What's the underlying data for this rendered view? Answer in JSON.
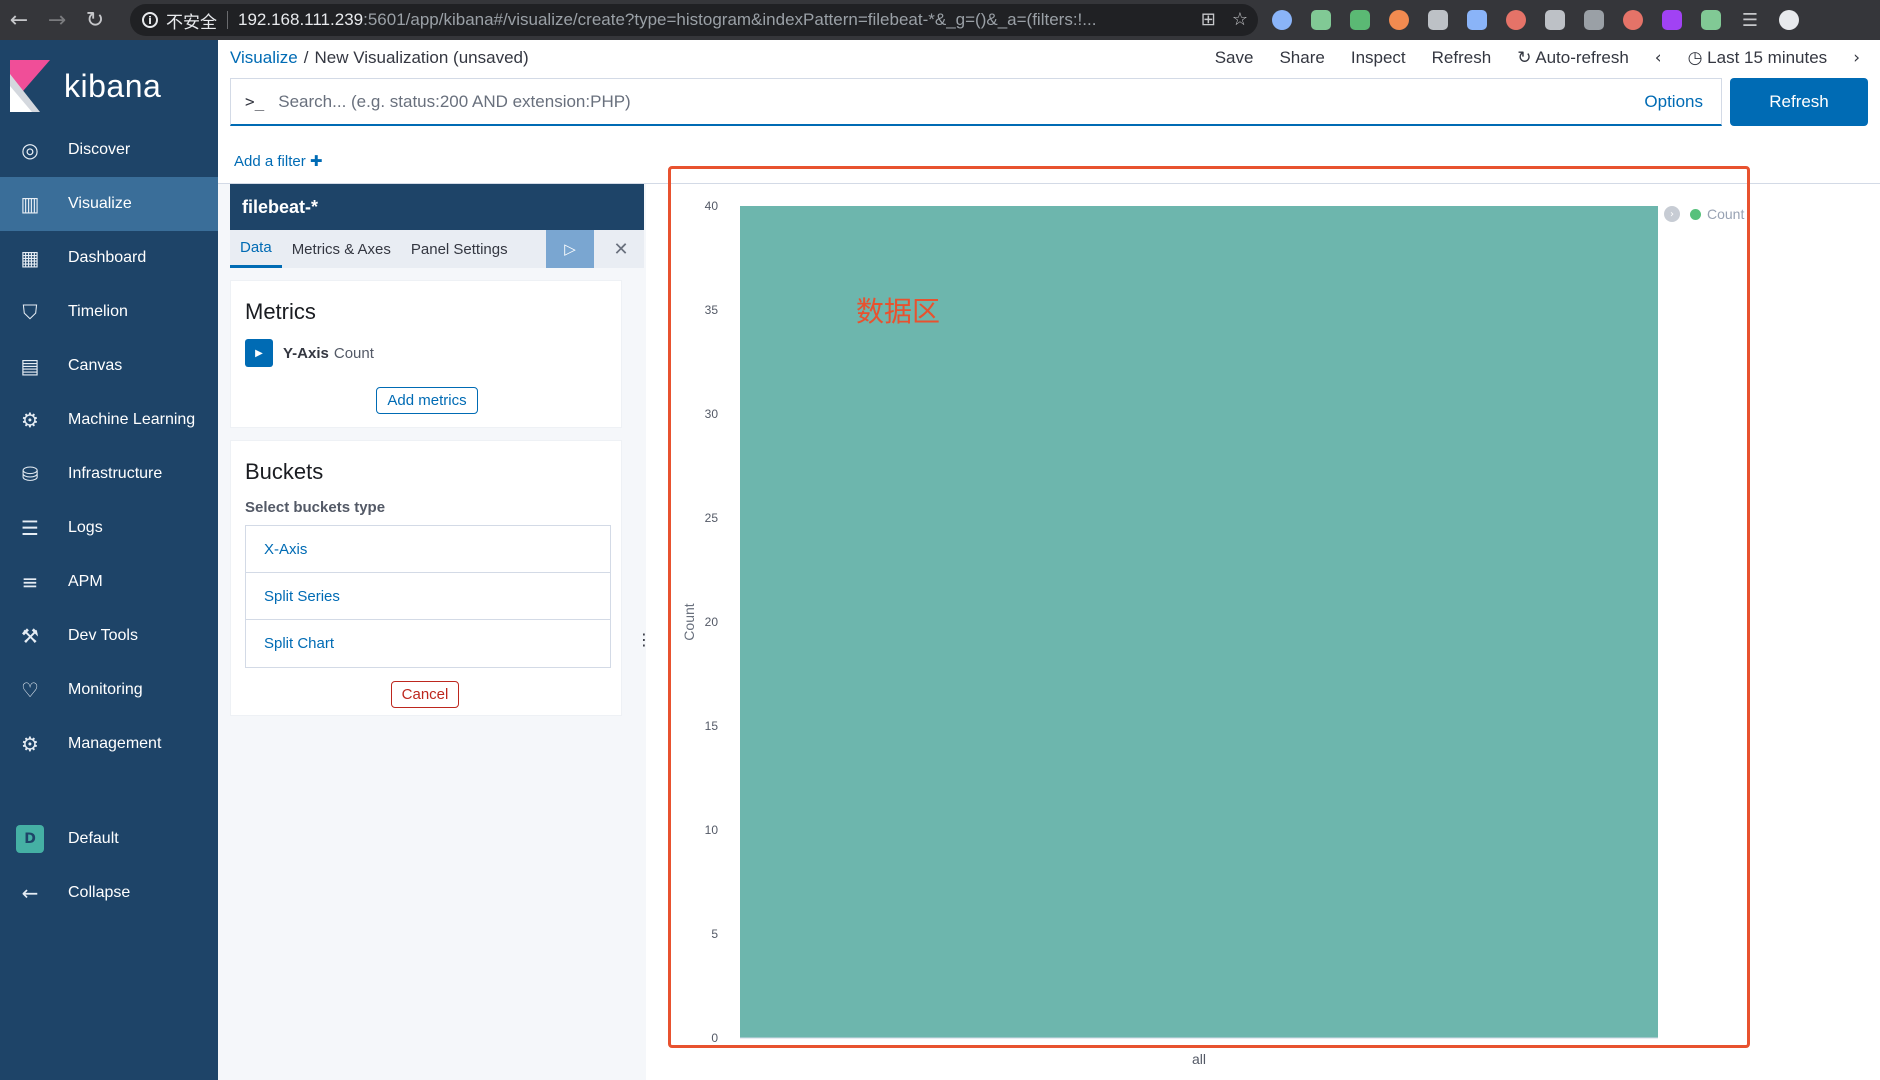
{
  "browser": {
    "insecure_label": "不安全",
    "url_host": "192.168.111.239",
    "url_rest": ":5601/app/kibana#/visualize/create?type=histogram&indexPattern=filebeat-*&_g=()&_a=(filters:!...",
    "extension_colors": [
      "#8ab4f8",
      "#81c995",
      "#5bb974",
      "#f28b50",
      "#bdc1c6",
      "#8ab4f8",
      "#e57368",
      "#bdc1c6",
      "#9aa0a6",
      "#e57368",
      "#a142f4",
      "#81c995"
    ]
  },
  "app": {
    "logo_text": "kibana"
  },
  "sidebar": {
    "items": [
      {
        "label": "Discover",
        "icon": "compass-icon"
      },
      {
        "label": "Visualize",
        "icon": "visualize-icon"
      },
      {
        "label": "Dashboard",
        "icon": "dashboard-icon"
      },
      {
        "label": "Timelion",
        "icon": "timelion-icon"
      },
      {
        "label": "Canvas",
        "icon": "canvas-icon"
      },
      {
        "label": "Machine Learning",
        "icon": "machine-learning-icon"
      },
      {
        "label": "Infrastructure",
        "icon": "infrastructure-icon"
      },
      {
        "label": "Logs",
        "icon": "logs-icon"
      },
      {
        "label": "APM",
        "icon": "apm-icon"
      },
      {
        "label": "Dev Tools",
        "icon": "wrench-icon"
      },
      {
        "label": "Monitoring",
        "icon": "heartbeat-icon"
      },
      {
        "label": "Management",
        "icon": "gear-icon"
      }
    ],
    "space_badge": "D",
    "space_label": "Default",
    "collapse_label": "Collapse"
  },
  "header": {
    "breadcrumb_root": "Visualize",
    "breadcrumb_sep": "/",
    "breadcrumb_current": "New Visualization (unsaved)",
    "menu": {
      "save": "Save",
      "share": "Share",
      "inspect": "Inspect",
      "refresh": "Refresh",
      "auto_refresh": "Auto-refresh",
      "time_range": "Last 15 minutes"
    }
  },
  "query": {
    "prompt": ">_",
    "placeholder": "Search... (e.g. status:200 AND extension:PHP)",
    "options_label": "Options",
    "refresh_button": "Refresh"
  },
  "filters": {
    "add_filter_label": "Add a filter",
    "add_symbol": "✚"
  },
  "editor": {
    "index_pattern": "filebeat-*",
    "tabs": [
      "Data",
      "Metrics & Axes",
      "Panel Settings"
    ],
    "active_tab": "Data",
    "metrics": {
      "title": "Metrics",
      "agg_label": "Y-Axis",
      "agg_value": "Count",
      "add_button": "Add metrics"
    },
    "buckets": {
      "title": "Buckets",
      "subtitle": "Select buckets type",
      "options": [
        "X-Axis",
        "Split Series",
        "Split Chart"
      ],
      "cancel_button": "Cancel"
    }
  },
  "annotation": {
    "text": "数据区",
    "color": "#e8522f"
  },
  "colors": {
    "sidebar_bg": "#1e4468",
    "sidebar_active": "#3a6e99",
    "accent": "#006bb4",
    "bar_fill": "#6db6ad",
    "legend_dot": "#57c17b",
    "highlight": "#e8522f"
  },
  "chart_data": {
    "type": "bar",
    "categories": [
      "all"
    ],
    "series": [
      {
        "name": "Count",
        "values": [
          40
        ]
      }
    ],
    "ylabel": "Count",
    "xlabel": "",
    "ylim": [
      0,
      40
    ],
    "yticks": [
      0,
      5,
      10,
      15,
      20,
      25,
      30,
      35,
      40
    ],
    "legend": {
      "entries": [
        "Count"
      ],
      "position": "top-right"
    },
    "grid": false
  }
}
